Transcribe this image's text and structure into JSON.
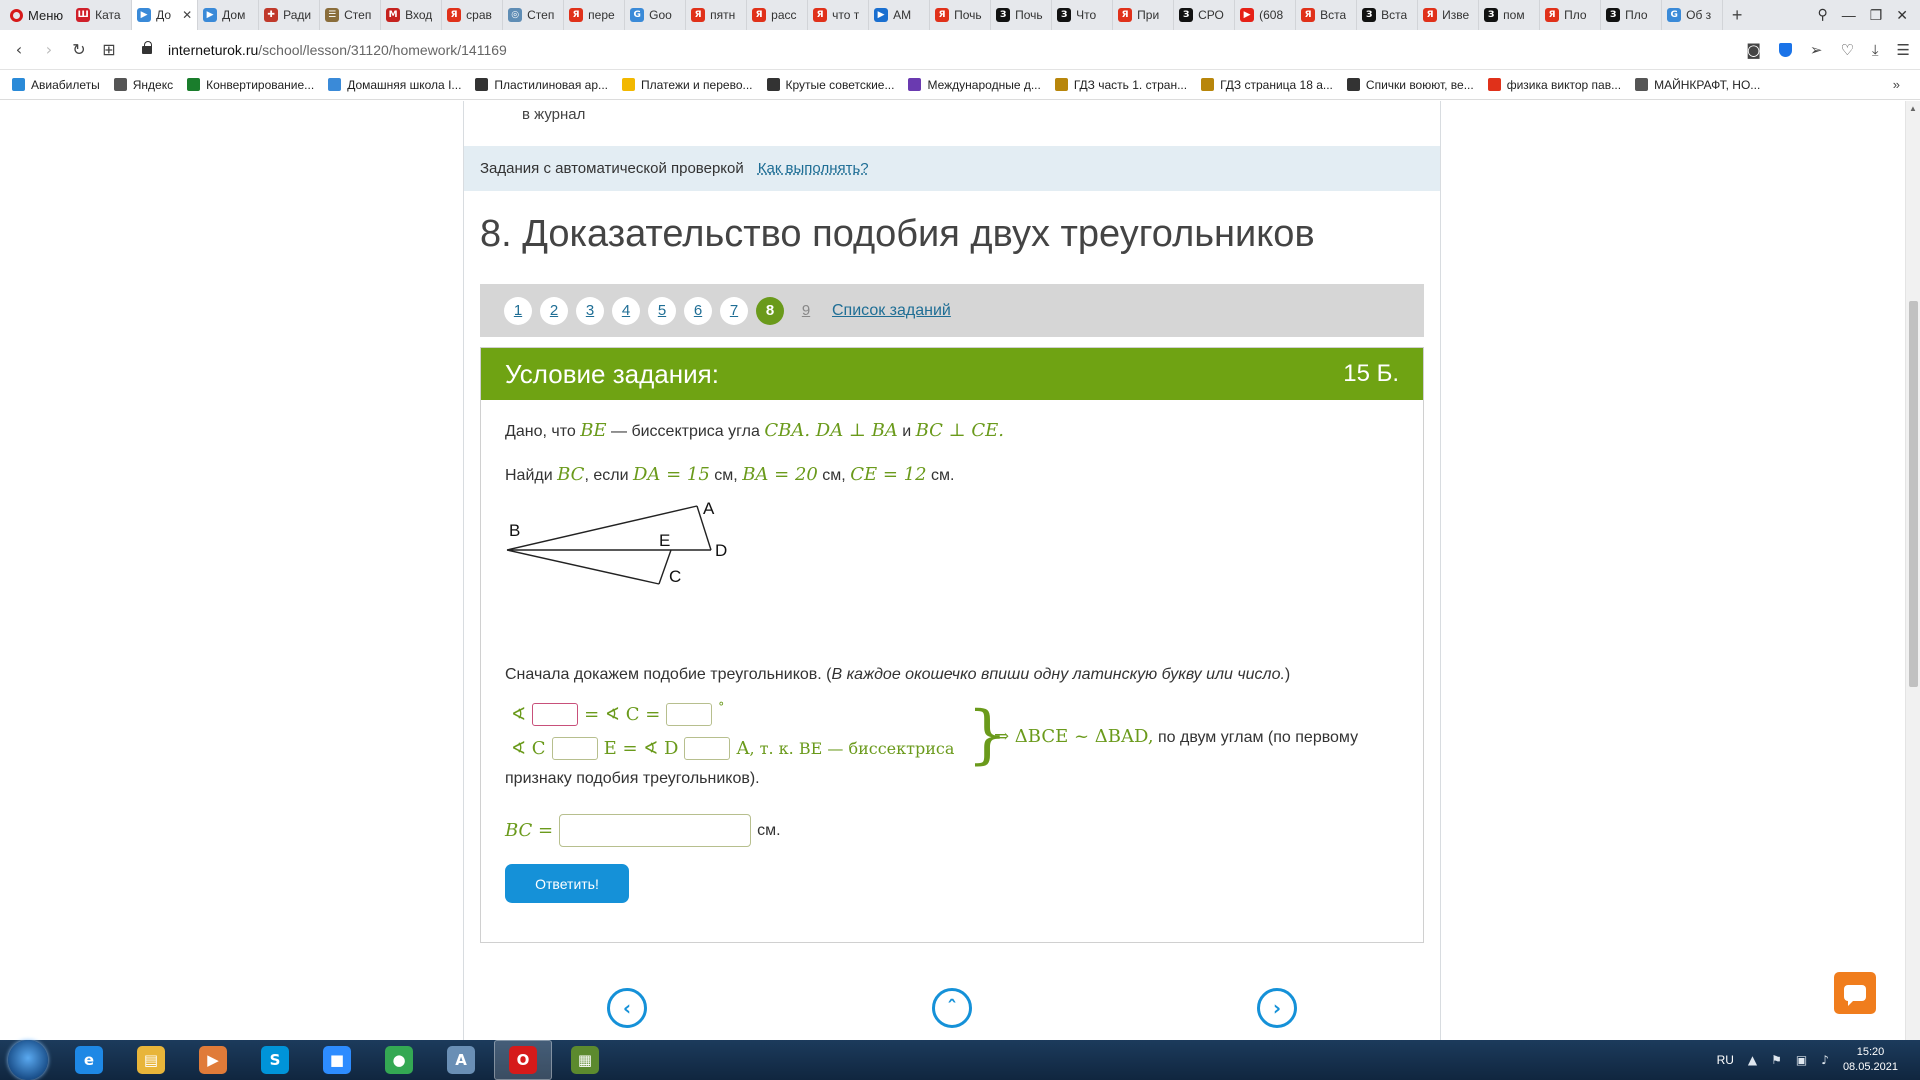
{
  "browser": {
    "menu_label": "Меню",
    "tabs": [
      {
        "title": "Ката",
        "color": "#d0202a",
        "glyph": "Ш"
      },
      {
        "title": "До",
        "color": "#3a8ad8",
        "glyph": "▶"
      },
      {
        "title": "Дом",
        "color": "#3a8ad8",
        "glyph": "▶"
      },
      {
        "title": "Ради",
        "color": "#c0392b",
        "glyph": "✚"
      },
      {
        "title": "Степ",
        "color": "#8a6d3b",
        "glyph": "☰"
      },
      {
        "title": "Вход",
        "color": "#c5221f",
        "glyph": "M"
      },
      {
        "title": "срав",
        "color": "#e0311a",
        "glyph": "Я"
      },
      {
        "title": "Степ",
        "color": "#5f8db5",
        "glyph": "◎"
      },
      {
        "title": "пере",
        "color": "#e0311a",
        "glyph": "Я"
      },
      {
        "title": "Goo",
        "color": "#3a8ad8",
        "glyph": "G"
      },
      {
        "title": "пятн",
        "color": "#e0311a",
        "glyph": "Я"
      },
      {
        "title": "расс",
        "color": "#e0311a",
        "glyph": "Я"
      },
      {
        "title": "что т",
        "color": "#e0311a",
        "glyph": "Я"
      },
      {
        "title": "AM",
        "color": "#1a6fd0",
        "glyph": "▶"
      },
      {
        "title": "Почь",
        "color": "#e0311a",
        "glyph": "Я"
      },
      {
        "title": "Почь",
        "color": "#111111",
        "glyph": "З"
      },
      {
        "title": "Что",
        "color": "#111111",
        "glyph": "З"
      },
      {
        "title": "При",
        "color": "#e0311a",
        "glyph": "Я"
      },
      {
        "title": "СРО",
        "color": "#111111",
        "glyph": "З"
      },
      {
        "title": "(608",
        "color": "#e62117",
        "glyph": "▶"
      },
      {
        "title": "Вста",
        "color": "#e0311a",
        "glyph": "Я"
      },
      {
        "title": "Вста",
        "color": "#111111",
        "glyph": "З"
      },
      {
        "title": "Изве",
        "color": "#e0311a",
        "glyph": "Я"
      },
      {
        "title": "пом",
        "color": "#111111",
        "glyph": "З"
      },
      {
        "title": "Пло",
        "color": "#e0311a",
        "glyph": "Я"
      },
      {
        "title": "Пло",
        "color": "#111111",
        "glyph": "З"
      },
      {
        "title": "Об з",
        "color": "#3a8ad8",
        "glyph": "G"
      }
    ],
    "active_tab_index": 1,
    "url_domain": "interneturok.ru",
    "url_path": "/school/lesson/31120/homework/141169",
    "bookmarks": [
      {
        "label": "Авиабилеты",
        "color": "#2a8ad8"
      },
      {
        "label": "Яндекс",
        "color": "#555555"
      },
      {
        "label": "Конвертирование...",
        "color": "#1a7d2c"
      },
      {
        "label": "Домашняя школа I...",
        "color": "#3a8ad8"
      },
      {
        "label": "Пластилиновая ар...",
        "color": "#333333"
      },
      {
        "label": "Платежи и перево...",
        "color": "#f2b800"
      },
      {
        "label": "Крутые советские...",
        "color": "#333333"
      },
      {
        "label": "Международные д...",
        "color": "#6a3ab0"
      },
      {
        "label": "ГДЗ часть 1. стран...",
        "color": "#b8860b"
      },
      {
        "label": "ГДЗ страница 18 а...",
        "color": "#b8860b"
      },
      {
        "label": "Спички воюют, ве...",
        "color": "#333333"
      },
      {
        "label": "физика виктор пав...",
        "color": "#e0311a"
      },
      {
        "label": "МАЙНКРАФТ, НО...",
        "color": "#555555"
      }
    ],
    "bookmarks_more": "»"
  },
  "page": {
    "journal_text": "в журнал",
    "autocheck_label": "Задания с автоматической проверкой",
    "autocheck_link": "Как выполнять?",
    "task_title": "8. Доказательство подобия двух треугольников",
    "pager": {
      "pages": [
        "1",
        "2",
        "3",
        "4",
        "5",
        "6",
        "7",
        "8",
        "9"
      ],
      "current": "8",
      "list_link": "Список заданий"
    },
    "task": {
      "header": "Условие задания:",
      "points": "15 Б.",
      "line1": {
        "t1": "Дано, что ",
        "m1": "BE",
        "t2": " — биссектриса угла ",
        "m2": "CBA",
        "t3": ". ",
        "m3": "DA ⊥ BA",
        "t4": " и ",
        "m4": "BC ⊥ CE",
        "t5": "."
      },
      "line2": {
        "t1": "Найди ",
        "m1": "BC",
        "t2": ", если ",
        "m2": "DA = 15",
        "t3": " см, ",
        "m3": "BA = 20",
        "t4": " см, ",
        "m4": "CE = 12",
        "t5": " см."
      },
      "figure_labels": {
        "B": "B",
        "A": "A",
        "E": "E",
        "D": "D",
        "C": "C"
      },
      "proof_intro": "Сначала докажем подобие треугольников. (",
      "proof_hint": "В каждое окошечко впиши одну латинскую букву или число.",
      "proof_intro_end": ")",
      "eq1": {
        "angle": "∢",
        "mid": "= ∢ C =",
        "deg": "°"
      },
      "eq2": {
        "a": "∢ C",
        "b": "E = ∢ D",
        "c": "A",
        "reason": ", т. к. BE —  биссектриса"
      },
      "conclusion": "⇒ ΔBCE ~ ΔBAD,",
      "conclusion_text": " по двум углам (по первому",
      "conclusion_text2": "признаку подобия треугольников).",
      "answer_label": "BC =",
      "answer_unit": "см.",
      "submit_label": "Ответить!"
    }
  },
  "taskbar": {
    "apps": [
      {
        "name": "ie",
        "color": "#1e88e5",
        "glyph": "e"
      },
      {
        "name": "explorer",
        "color": "#e8b53a",
        "glyph": "▤"
      },
      {
        "name": "media",
        "color": "#e07b39",
        "glyph": "▶"
      },
      {
        "name": "skype",
        "color": "#0094d9",
        "glyph": "S"
      },
      {
        "name": "zoom",
        "color": "#2d8cff",
        "glyph": "■"
      },
      {
        "name": "chrome",
        "color": "#34a853",
        "glyph": "●"
      },
      {
        "name": "notepad",
        "color": "#6a8fb5",
        "glyph": "A"
      },
      {
        "name": "opera",
        "color": "#d61a1a",
        "glyph": "O"
      },
      {
        "name": "minecraft",
        "color": "#5c8a2e",
        "glyph": "▦"
      }
    ],
    "active_app": "opera",
    "lang": "RU",
    "time": "15:20",
    "date": "08.05.2021"
  }
}
